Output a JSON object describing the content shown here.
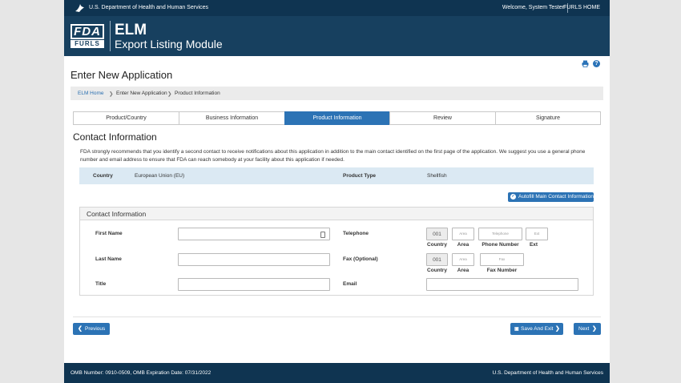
{
  "topbar": {
    "agency": "U.S. Department of Health and Human Services",
    "welcome": "Welcome, System Tester",
    "home_link": "FURLS HOME",
    "logo_icon": "hhs-eagle-icon"
  },
  "banner": {
    "logo_top": "FDA",
    "logo_bottom": "FURLS",
    "app_abbr": "ELM",
    "app_name": "Export Listing Module"
  },
  "tools": {
    "print_icon": "printer-icon",
    "help_icon": "help-icon",
    "help_glyph": "?"
  },
  "page_title": "Enter New Application",
  "breadcrumb": {
    "items": [
      "ELM Home",
      "Enter New Application",
      "Product Information"
    ],
    "separator": "❯"
  },
  "steps": [
    {
      "label": "Product/Country",
      "active": false
    },
    {
      "label": "Business Information",
      "active": false
    },
    {
      "label": "Product Information",
      "active": true
    },
    {
      "label": "Review",
      "active": false
    },
    {
      "label": "Signature",
      "active": false
    }
  ],
  "section": {
    "title": "Contact Information",
    "intro": "FDA strongly recommends that you identify a second contact to receive notifications about this application in addition to the main contact identified on the first page of the application. We suggest you use a general phone number and email address to ensure that FDA can reach somebody at your facility about this application if needed."
  },
  "summary": {
    "country_label": "Country",
    "country_value": "European Union (EU)",
    "product_type_label": "Product Type",
    "product_type_value": "Shellfish"
  },
  "autofill": {
    "label": "Autofill Main Contact Information",
    "icon": "check-circle-icon"
  },
  "contact_form": {
    "title": "Contact Information",
    "first_name": {
      "label": "First Name",
      "value": ""
    },
    "last_name": {
      "label": "Last Name",
      "value": ""
    },
    "title_field": {
      "label": "Title",
      "value": ""
    },
    "telephone": {
      "label": "Telephone",
      "country_value": "001",
      "area_placeholder": "Area",
      "number_placeholder": "Telephone",
      "ext_placeholder": "Ext",
      "country_caption": "Country",
      "area_caption": "Area",
      "number_caption": "Phone Number",
      "ext_caption": "Ext"
    },
    "fax": {
      "label": "Fax  (Optional)",
      "country_value": "001",
      "area_placeholder": "Area",
      "number_placeholder": "Fax",
      "country_caption": "Country",
      "area_caption": "Area",
      "number_caption": "Fax Number"
    },
    "email": {
      "label": "Email",
      "value": ""
    }
  },
  "nav": {
    "previous": "Previous",
    "save_exit": "Save And Exit",
    "next": "Next",
    "prev_glyph": "❮",
    "next_glyph": "❯",
    "save_glyph": "▣"
  },
  "footer": {
    "omb": "OMB Number: 0910-0509, OMB Expiration Date: 07/31/2022",
    "dept": "U.S. Department of Health and Human Services"
  }
}
